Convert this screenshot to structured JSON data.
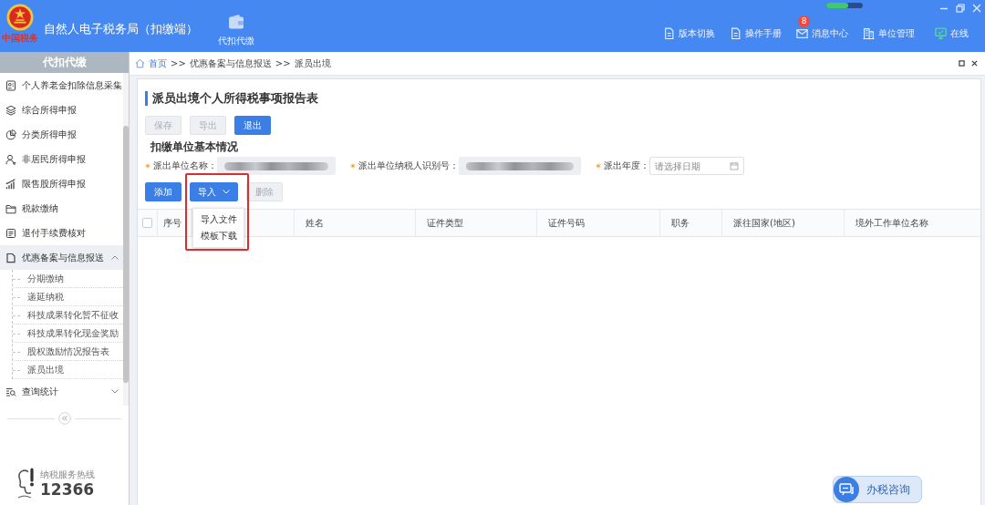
{
  "app_bar": {
    "logo_text": "中国税务",
    "title": "自然人电子税务局（扣缴端）",
    "nav": [
      {
        "label": "代扣代缴"
      }
    ],
    "tools": [
      {
        "label": "版本切换"
      },
      {
        "label": "操作手册"
      },
      {
        "label": "消息中心",
        "badge": "8"
      },
      {
        "label": "单位管理"
      },
      {
        "label": "在线"
      }
    ]
  },
  "sidebar": {
    "title": "代扣代缴",
    "items": [
      {
        "label": "个人养老金扣除信息采集"
      },
      {
        "label": "综合所得申报"
      },
      {
        "label": "分类所得申报"
      },
      {
        "label": "非居民所得申报"
      },
      {
        "label": "限售股所得申报"
      },
      {
        "label": "税款缴纳"
      },
      {
        "label": "退付手续费核对"
      },
      {
        "label": "优惠备案与信息报送",
        "expanded": true,
        "children": [
          {
            "label": "分期缴纳"
          },
          {
            "label": "递延纳税"
          },
          {
            "label": "科技成果转化暂不征收"
          },
          {
            "label": "科技成果转化现金奖励"
          },
          {
            "label": "股权激励情况报告表"
          },
          {
            "label": "派员出境"
          }
        ]
      },
      {
        "label": "查询统计",
        "expanded": false
      }
    ],
    "hotline": {
      "caption": "纳税服务热线",
      "number": "12366"
    }
  },
  "breadcrumb": [
    {
      "kind": "link",
      "label": "首页"
    },
    {
      "kind": "separator",
      "label": ">>"
    },
    {
      "kind": "text",
      "label": "优惠备案与信息报送"
    },
    {
      "kind": "separator",
      "label": ">>"
    },
    {
      "kind": "text",
      "label": "派员出境"
    }
  ],
  "form": {
    "title": "派员出境个人所得税事项报告表",
    "buttons": [
      {
        "label": "保存",
        "disabled": true
      },
      {
        "label": "导出",
        "disabled": true
      },
      {
        "label": "退出",
        "disabled": false
      }
    ],
    "section_title": "扣缴单位基本情况",
    "fields": [
      {
        "kind": "masked",
        "label": "派出单位名称：",
        "required": true
      },
      {
        "kind": "masked",
        "label": "派出单位纳税人识别号：",
        "required": true
      },
      {
        "kind": "date",
        "label": "派出年度：",
        "required": true,
        "placeholder": "请选择日期"
      }
    ],
    "actions": [
      {
        "kind": "button",
        "label": "添加",
        "disabled": false,
        "highlighted": false
      },
      {
        "kind": "dropdown",
        "label": "导入",
        "disabled": false,
        "highlighted": true,
        "expanded": true,
        "menu": [
          {
            "label": "导入文件"
          },
          {
            "label": "模板下载"
          }
        ]
      },
      {
        "kind": "button",
        "label": "删除",
        "disabled": true,
        "highlighted": false
      }
    ]
  },
  "table": {
    "select_all": {
      "checked": false
    },
    "columns": [
      "序号",
      "姓名",
      "证件类型",
      "证件号码",
      "职务",
      "派往国家(地区)",
      "境外工作单位名称"
    ]
  },
  "consult": {
    "label": "办税咨询"
  }
}
